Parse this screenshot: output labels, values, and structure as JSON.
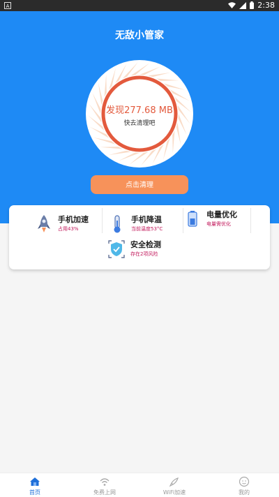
{
  "status_bar": {
    "app_glyph": "A",
    "time": "2:38"
  },
  "header": {
    "title": "无敌小管家"
  },
  "gauge": {
    "found_text": "发现277.68 MB",
    "sub_text": "快去清理吧"
  },
  "clean_button": {
    "label": "点击清理"
  },
  "features": [
    {
      "title": "手机加速",
      "subtitle": "占用43%",
      "icon": "rocket-icon"
    },
    {
      "title": "手机降温",
      "subtitle": "当前温度53°C",
      "icon": "thermometer-icon"
    },
    {
      "title": "电量优化",
      "subtitle": "电量需优化",
      "icon": "battery-icon"
    },
    {
      "title": "安全检测",
      "subtitle": "存在2项风险",
      "icon": "shield-icon"
    }
  ],
  "tabs": [
    {
      "label": "首页",
      "icon": "home-icon",
      "active": true
    },
    {
      "label": "免费上网",
      "icon": "wifi-icon",
      "active": false
    },
    {
      "label": "WiFi加速",
      "icon": "rocket-icon",
      "active": false
    },
    {
      "label": "我的",
      "icon": "user-icon",
      "active": false
    }
  ],
  "colors": {
    "brand_blue": "#1e8af5",
    "accent_orange": "#f7925a",
    "ring_red": "#e35a3d"
  }
}
